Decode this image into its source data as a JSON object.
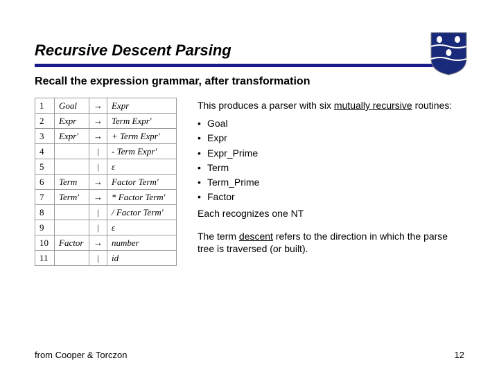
{
  "title": "Recursive Descent Parsing",
  "subtitle": "Recall the expression grammar, after transformation",
  "grammar": [
    {
      "n": "1",
      "lhs": "Goal",
      "arr": "→",
      "rhs": "Expr"
    },
    {
      "n": "2",
      "lhs": "Expr",
      "arr": "→",
      "rhs": "Term Expr'"
    },
    {
      "n": "3",
      "lhs": "Expr'",
      "arr": "→",
      "rhs": "+ Term Expr'"
    },
    {
      "n": "4",
      "lhs": "",
      "arr": "|",
      "rhs": "- Term Expr'"
    },
    {
      "n": "5",
      "lhs": "",
      "arr": "|",
      "rhs": "ε"
    },
    {
      "n": "6",
      "lhs": "Term",
      "arr": "→",
      "rhs": "Factor Term'"
    },
    {
      "n": "7",
      "lhs": "Term'",
      "arr": "→",
      "rhs": "* Factor Term'"
    },
    {
      "n": "8",
      "lhs": "",
      "arr": "|",
      "rhs": "/ Factor Term'"
    },
    {
      "n": "9",
      "lhs": "",
      "arr": "|",
      "rhs": "ε"
    },
    {
      "n": "10",
      "lhs": "Factor",
      "arr": "→",
      "rhs": "number"
    },
    {
      "n": "11",
      "lhs": "",
      "arr": "|",
      "rhs": "id"
    }
  ],
  "right": {
    "intro_a": "This produces a parser with six ",
    "intro_b": "mutually recursive",
    "intro_c": " routines:",
    "bullets": [
      "Goal",
      "Expr",
      "Expr_Prime",
      "Term",
      "Term_Prime",
      "Factor"
    ],
    "tail": "Each recognizes one NT",
    "para2_a": "The term ",
    "para2_b": "descent",
    "para2_c": " refers to the direction in which the parse tree is traversed (or built)."
  },
  "footer": {
    "left": "from Cooper & Torczon",
    "right": "12"
  },
  "shield_color": "#1a2a7a"
}
